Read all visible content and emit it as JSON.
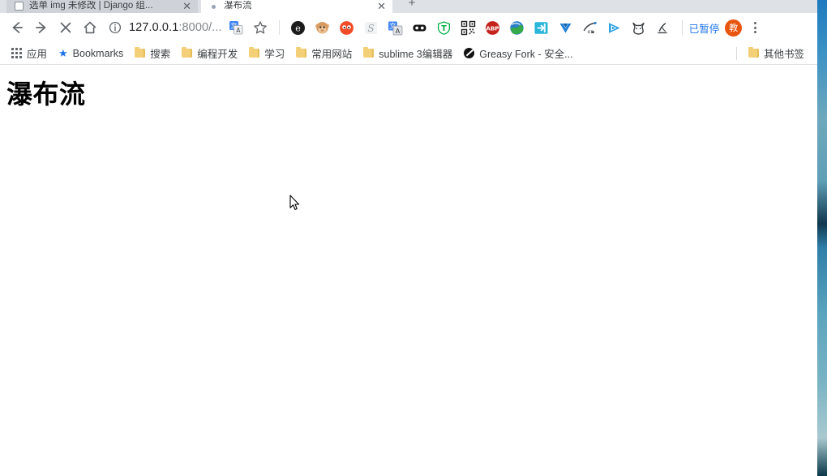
{
  "window": {
    "tabs": [
      {
        "title": "选单 img 未修改 | Django 组...",
        "favicon": "document-icon",
        "close_label": "✕",
        "active": false
      },
      {
        "title": "瀑布流",
        "favicon": "loading-dot-icon",
        "close_label": "✕",
        "active": true
      }
    ],
    "new_tab_label": "+"
  },
  "toolbar": {
    "back_label": "←",
    "forward_label": "→",
    "stop_label": "✕",
    "home_label": "⌂",
    "url_secure": "127.0.0.1",
    "url_rest": ":8000/...",
    "site_info_label": "ⓘ",
    "translate_label": "译",
    "bookmark_star_label": "☆",
    "extensions": [
      {
        "name": "edge-e-icon",
        "glyph": "e"
      },
      {
        "name": "monkey-icon",
        "glyph": "🐵"
      },
      {
        "name": "orange-face-icon",
        "glyph": "◉"
      },
      {
        "name": "scribd-s-icon",
        "glyph": "S"
      },
      {
        "name": "google-translate-icon",
        "glyph": "文"
      },
      {
        "name": "black-glasses-icon",
        "glyph": "●●"
      },
      {
        "name": "tampermonkey-shield-icon",
        "glyph": "T"
      },
      {
        "name": "qr-code-icon",
        "glyph": "▦"
      },
      {
        "name": "adblock-plus-icon",
        "glyph": "ABP"
      },
      {
        "name": "globe-icon",
        "glyph": "🌐"
      },
      {
        "name": "import-arrow-icon",
        "glyph": "⇥"
      },
      {
        "name": "blue-v-icon",
        "glyph": "V"
      },
      {
        "name": "script-en-icon",
        "glyph": "en"
      },
      {
        "name": "blue-play-icon",
        "glyph": "▶"
      },
      {
        "name": "fox-outline-icon",
        "glyph": "M"
      },
      {
        "name": "pen-mark-icon",
        "glyph": "↙"
      }
    ],
    "paused_label": "已暂停",
    "avatar_label": "教",
    "menu_label": "⋮"
  },
  "bookmarks_bar": {
    "items": [
      {
        "label": "应用",
        "icon": "apps-grid-icon"
      },
      {
        "label": "Bookmarks",
        "icon": "star-icon"
      },
      {
        "label": "搜索",
        "icon": "folder-icon"
      },
      {
        "label": "编程开发",
        "icon": "folder-icon"
      },
      {
        "label": "学习",
        "icon": "folder-icon"
      },
      {
        "label": "常用网站",
        "icon": "folder-icon"
      },
      {
        "label": "sublime 3编辑器",
        "icon": "folder-icon"
      },
      {
        "label": "Greasy Fork - 安全...",
        "icon": "greasy-fork-icon"
      }
    ],
    "other_bookmarks": {
      "label": "其他书签",
      "icon": "folder-icon"
    }
  },
  "page": {
    "heading": "瀑布流"
  },
  "colors": {
    "accent_blue": "#1a73e8",
    "tabstrip_bg": "#dee1e6",
    "inactive_tab": "#cfd3d9",
    "avatar_orange": "#e8550f",
    "folder_yellow": "#f3d077",
    "desktop_blue": "#2f7fa8"
  }
}
